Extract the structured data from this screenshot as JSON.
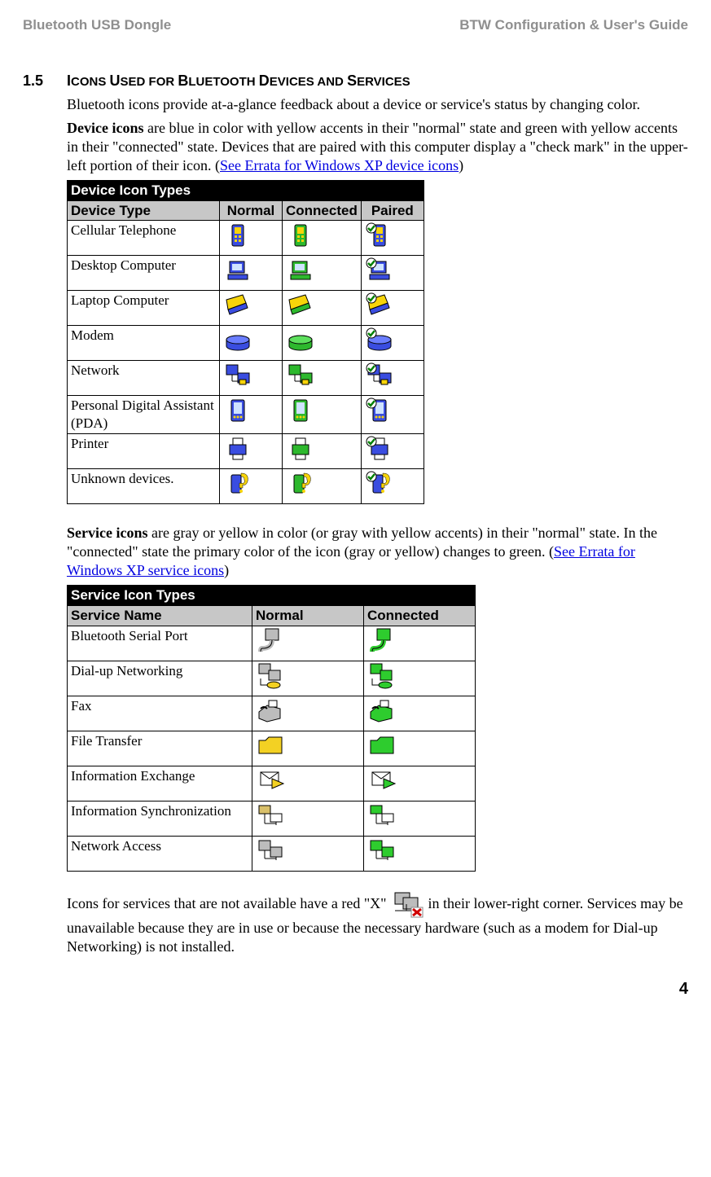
{
  "header": {
    "left": "Bluetooth USB Dongle",
    "right": "BTW Configuration & User's Guide"
  },
  "section": {
    "number": "1.5",
    "title_pre": "I",
    "title_rest": "CONS USED FOR BLUETOOTH DEVICES AND SERVICES"
  },
  "intro": "Bluetooth icons provide at-a-glance feedback about a device or service's status by changing color.",
  "device_para": {
    "lead": "Device icons",
    "rest": " are blue in color with yellow accents in their \"normal\" state and green with yellow accents in their \"connected\" state. Devices that are paired with this computer display a \"check mark\" in the upper-left portion of their icon. (",
    "link": "See Errata for Windows XP device icons",
    "close": ")"
  },
  "device_table": {
    "title": "Device Icon Types",
    "headers": [
      "Device Type",
      "Normal",
      "Connected",
      "Paired"
    ],
    "rows": [
      "Cellular Telephone",
      "Desktop Computer",
      "Laptop Computer",
      "Modem",
      "Network",
      "Personal Digital Assistant (PDA)",
      "Printer",
      "Unknown devices."
    ]
  },
  "service_para": {
    "lead": "Service icons",
    "rest": " are gray or yellow in color (or gray with yellow accents) in their \"normal\" state. In the \"connected\" state the primary color of the icon (gray or yellow) changes to green. (",
    "link": "See Errata for Windows XP service icons",
    "close": ")"
  },
  "service_table": {
    "title": "Service Icon Types",
    "headers": [
      "Service Name",
      "Normal",
      "Connected"
    ],
    "rows": [
      "Bluetooth Serial Port",
      "Dial-up Networking",
      "Fax",
      "File Transfer",
      "Information Exchange",
      "Information Synchronization",
      "Network Access"
    ]
  },
  "unavail_para": {
    "pre": "Icons for services that are not available have a red \"X\" ",
    "post": " in their lower-right corner. Services may be unavailable because they are in use or because the necessary hardware (such as a modem for Dial-up Networking) is not installed."
  },
  "page_number": "4"
}
